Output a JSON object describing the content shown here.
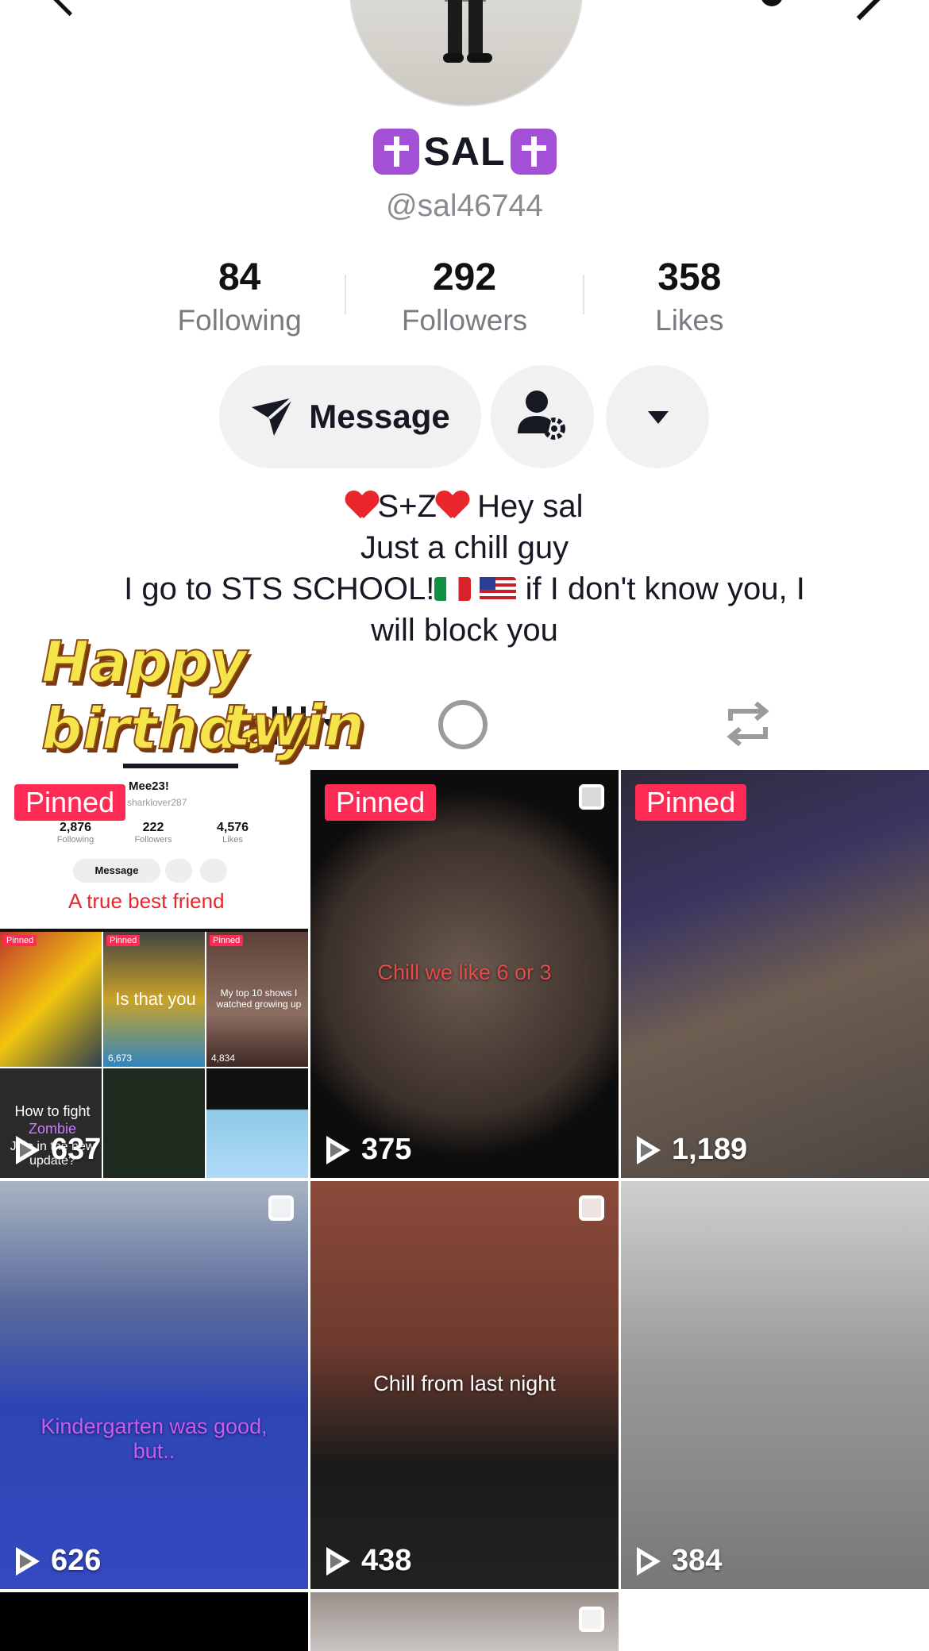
{
  "profile": {
    "display_name": "SAL",
    "username": "@sal46744",
    "stats": [
      {
        "value": "84",
        "label": "Following"
      },
      {
        "value": "292",
        "label": "Followers"
      },
      {
        "value": "358",
        "label": "Likes"
      }
    ],
    "message_label": "Message",
    "bio": {
      "line1_text": "S+Z",
      "line1_tail": " Hey sal",
      "line2": "Just a chill guy",
      "line3_start": "I go to STS SCHOOL!",
      "line3_end": " if I don't know you, I",
      "line4": "will block you"
    }
  },
  "sticker": {
    "line1": "Happy birthday",
    "line2": "twin"
  },
  "videos": [
    {
      "pinned": "Pinned",
      "views": "637",
      "mini_profile": {
        "name": "Mee23!",
        "handle": "sharklover287",
        "stats": [
          {
            "value": "2,876",
            "label": "Following"
          },
          {
            "value": "222",
            "label": "Followers"
          },
          {
            "value": "4,576",
            "label": "Likes"
          }
        ],
        "message": "Message",
        "caption": "A true best friend",
        "tiles": [
          {
            "pinned": "Pinned",
            "text": ""
          },
          {
            "pinned": "Pinned",
            "text": "Is that you",
            "views": "6,673"
          },
          {
            "pinned": "Pinned",
            "text": "My top 10 shows I watched growing up",
            "views": "4,834"
          }
        ],
        "tile_fight": "How to fight",
        "tile_zombie": "Zombie",
        "tile_rest": "Jojo in the new update?"
      }
    },
    {
      "pinned": "Pinned",
      "views": "375",
      "caption": "Chill we like 6 or 3"
    },
    {
      "pinned": "Pinned",
      "views": "1,189"
    },
    {
      "views": "626",
      "caption": "Kindergarten was good, but.."
    },
    {
      "views": "438",
      "caption": "Chill from last night"
    },
    {
      "views": "384"
    }
  ],
  "colors": {
    "pinned_bg": "#fe2c55",
    "accent_purple": "#a34fd6",
    "heart_red": "#e8262c"
  },
  "icons": {
    "back": "chevron-left-icon",
    "message": "send-icon",
    "person_settings": "person-gear-icon",
    "dropdown": "caret-down-icon",
    "grid_tab": "grid-icon",
    "liked_tab": "liked-icon",
    "repost_tab": "repost-icon",
    "play": "play-icon",
    "multi": "multi-post-icon"
  }
}
